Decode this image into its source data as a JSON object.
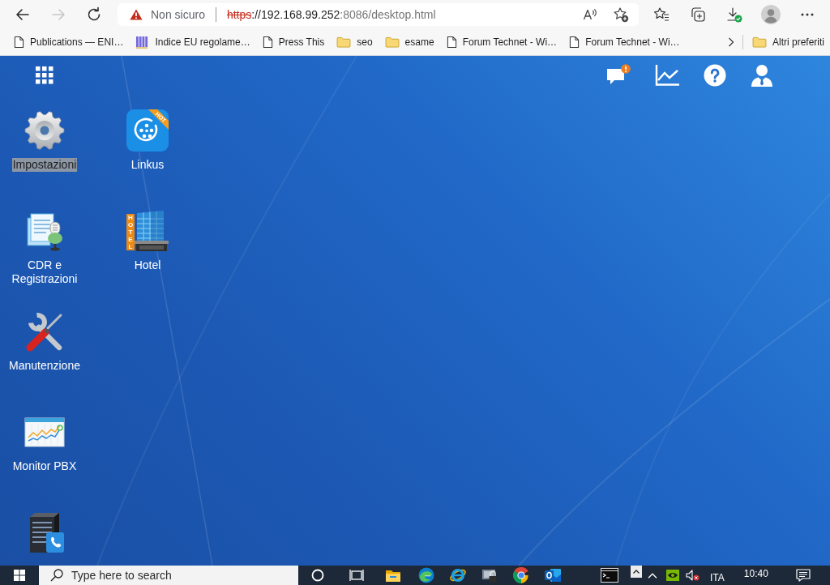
{
  "browser": {
    "nav": [
      {
        "kind": "back",
        "disabled": false
      },
      {
        "kind": "forward",
        "disabled": true
      },
      {
        "kind": "reload",
        "disabled": false
      }
    ],
    "address_bar": {
      "security": "Non sicuro",
      "scheme": "https",
      "host": "://192.168.99.252",
      "path": ":8086/desktop.html"
    },
    "bookmarks": [
      {
        "kind": "page",
        "label": "Publications — ENI…"
      },
      {
        "kind": "book",
        "label": "Indice EU regolame…"
      },
      {
        "kind": "page",
        "label": "Press This"
      },
      {
        "kind": "folder",
        "label": "seo"
      },
      {
        "kind": "folder",
        "label": "esame"
      },
      {
        "kind": "page",
        "label": "Forum Technet - Wi…"
      },
      {
        "kind": "page",
        "label": "Forum Technet - Wi…"
      }
    ],
    "other_bookmarks": {
      "kind": "folder",
      "label": "Altri preferiti"
    }
  },
  "desktop": {
    "app_rows": [
      [
        {
          "kind": "settings",
          "label": "Impostazioni",
          "selected": true
        },
        {
          "kind": "linkus",
          "label": "Linkus",
          "ribbon": "HOT",
          "selected": false
        }
      ],
      [
        {
          "kind": "cdr",
          "label": "CDR e Registrazioni",
          "selected": false
        },
        {
          "kind": "hotel",
          "label": "Hotel",
          "sign": "HOTEL",
          "selected": false
        }
      ],
      [
        {
          "kind": "maintenance",
          "label": "Manutenzione",
          "selected": false
        }
      ],
      [
        {
          "kind": "monitor",
          "label": "Monitor PBX",
          "selected": false
        }
      ],
      [
        {
          "kind": "server",
          "selected": false
        }
      ]
    ]
  },
  "taskbar": {
    "search": {
      "placeholder": "Type here to search"
    },
    "pinned": [
      {
        "kind": "cortana"
      },
      {
        "kind": "task_view"
      },
      {
        "kind": "file_explorer"
      },
      {
        "kind": "edge"
      },
      {
        "kind": "ie"
      },
      {
        "kind": "lock_app"
      },
      {
        "kind": "chrome"
      },
      {
        "kind": "outlook"
      },
      {
        "kind": "terminal"
      }
    ],
    "tray": {
      "language": "ITA",
      "time": "10:40"
    }
  }
}
